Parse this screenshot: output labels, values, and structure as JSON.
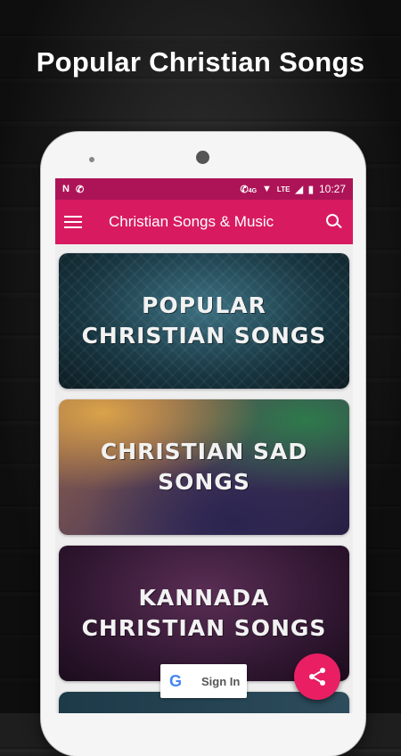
{
  "headline": "Popular Christian Songs",
  "status_bar": {
    "left_icons": [
      "n-notification-icon",
      "phone-call-icon"
    ],
    "signal_label": "4G",
    "network_label": "LTE",
    "time": "10:27"
  },
  "app_bar": {
    "title": "Christian Songs & Music",
    "menu_icon": "hamburger-menu-icon",
    "search_icon": "search-icon"
  },
  "cards": [
    {
      "text": "POPULAR\nCHRISTIAN SONGS"
    },
    {
      "text": "CHRISTIAN SAD\nSONGS"
    },
    {
      "text": "KANNADA\nCHRISTIAN SONGS"
    }
  ],
  "sign_in": {
    "label": "Sign In",
    "icon": "google-g-icon"
  },
  "fab": {
    "icon": "share-icon"
  },
  "colors": {
    "status_bar": "#ad1457",
    "app_bar": "#d81b60",
    "fab": "#e91e63"
  }
}
